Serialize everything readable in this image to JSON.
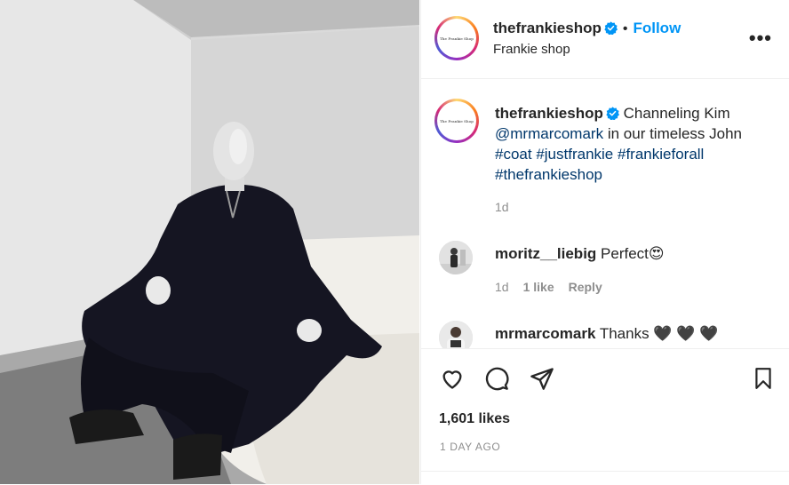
{
  "post": {
    "header": {
      "username": "thefrankieshop",
      "separator": "•",
      "follow_label": "Follow",
      "subtitle": "Frankie shop",
      "more_label": "•••",
      "avatar_logo_text": "The Frankie Shop"
    },
    "caption": {
      "username": "thefrankieshop",
      "text_start": "Channeling Kim",
      "mention": "@mrmarcomark",
      "text_middle": "in our timeless John",
      "hashtags": [
        "#coat",
        "#justfrankie",
        "#frankieforall",
        "#thefrankieshop"
      ],
      "time": "1d"
    },
    "comments": [
      {
        "username": "moritz__liebig",
        "text": "Perfect",
        "emoji": "😍",
        "time": "1d",
        "likes": "1 like",
        "reply_label": "Reply"
      },
      {
        "username": "mrmarcomark",
        "text": "Thanks",
        "emoji": "🖤 🖤 🖤"
      }
    ],
    "actions": {
      "like_icon": "heart-icon",
      "comment_icon": "comment-icon",
      "share_icon": "paper-plane-icon",
      "save_icon": "bookmark-icon"
    },
    "likes_text": "1,601 likes",
    "timestamp": "1 DAY AGO",
    "colors": {
      "accent_blue": "#0095f6",
      "link_blue": "#00376b",
      "text_primary": "#262626",
      "text_secondary": "#8e8e8e"
    }
  }
}
